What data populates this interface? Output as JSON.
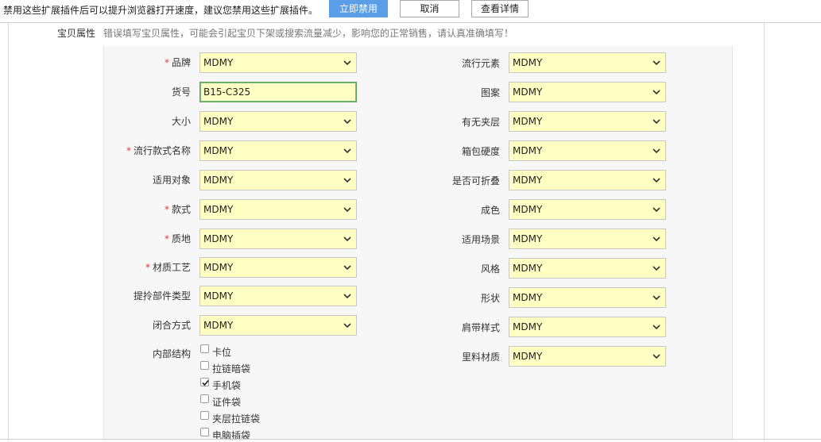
{
  "notice": {
    "text": "禁用这些扩展插件后可以提升浏览器打开速度，建议您禁用这些扩展插件。",
    "disable_now_label": "立即禁用",
    "cancel_label": "取消",
    "details_label": "查看详情"
  },
  "section": {
    "label": "宝贝属性",
    "hint": "错误填写宝贝属性，可能会引起宝贝下架或搜索流量减少，影响您的正常销售，请认真准确填写！"
  },
  "left_fields": [
    {
      "label": "品牌",
      "required": "*",
      "value": "MDMY"
    },
    {
      "label": "货号",
      "required": "",
      "value": "B15-C325"
    },
    {
      "label": "大小",
      "required": "",
      "value": "MDMY"
    },
    {
      "label": "流行款式名称",
      "required": "*",
      "value": "MDMY"
    },
    {
      "label": "适用对象",
      "required": "",
      "value": "MDMY"
    },
    {
      "label": "款式",
      "required": "*",
      "value": "MDMY"
    },
    {
      "label": "质地",
      "required": "*",
      "value": "MDMY"
    },
    {
      "label": "材质工艺",
      "required": "*",
      "value": "MDMY"
    },
    {
      "label": "提拎部件类型",
      "required": "",
      "value": "MDMY"
    },
    {
      "label": "闭合方式",
      "required": "",
      "value": "MDMY"
    }
  ],
  "right_fields": [
    {
      "label": "流行元素",
      "value": "MDMY"
    },
    {
      "label": "图案",
      "value": "MDMY"
    },
    {
      "label": "有无夹层",
      "value": "MDMY"
    },
    {
      "label": "箱包硬度",
      "value": "MDMY"
    },
    {
      "label": "是否可折叠",
      "value": "MDMY"
    },
    {
      "label": "成色",
      "value": "MDMY"
    },
    {
      "label": "适用场景",
      "value": "MDMY"
    },
    {
      "label": "风格",
      "value": "MDMY"
    },
    {
      "label": "形状",
      "value": "MDMY"
    },
    {
      "label": "肩带样式",
      "value": "MDMY"
    },
    {
      "label": "里料材质",
      "value": "MDMY"
    }
  ],
  "inner_structure": {
    "label": "内部结构",
    "options": [
      {
        "label": "卡位",
        "checked": false
      },
      {
        "label": "拉链暗袋",
        "checked": false
      },
      {
        "label": "手机袋",
        "checked": true
      },
      {
        "label": "证件袋",
        "checked": false
      },
      {
        "label": "夹层拉链袋",
        "checked": false
      },
      {
        "label": "电脑插袋",
        "checked": false
      }
    ]
  },
  "colors": {
    "select_bg": "#ffffc4",
    "primary_button": "#5b9ee8",
    "required_star": "#e4393c",
    "focus_border": "#5aa35a"
  },
  "icons": {
    "dropdown": "chevron-down-icon",
    "checkbox": "checkbox-icon",
    "checkmark": "checkmark-icon"
  }
}
